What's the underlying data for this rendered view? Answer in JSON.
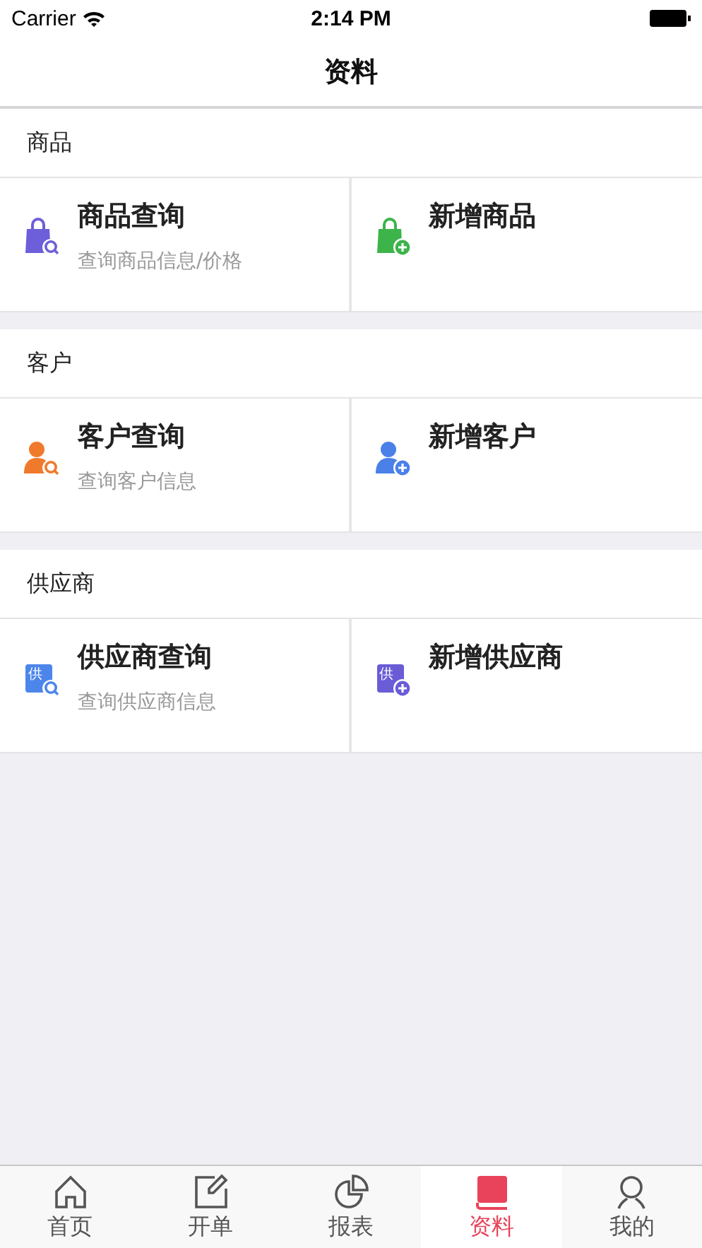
{
  "status_bar": {
    "carrier": "Carrier",
    "time": "2:14 PM"
  },
  "nav": {
    "title": "资料"
  },
  "sections": [
    {
      "title": "商品",
      "items": [
        {
          "kind": "search",
          "color": "#6c5fd9",
          "title": "商品查询",
          "subtitle": "查询商品信息/价格"
        },
        {
          "kind": "add",
          "color": "#3cb44a",
          "title": "新增商品"
        }
      ]
    },
    {
      "title": "客户",
      "items": [
        {
          "kind": "search",
          "color": "#f07a2c",
          "title": "客户查询",
          "subtitle": "查询客户信息"
        },
        {
          "kind": "add",
          "color": "#4a80e8",
          "title": "新增客户"
        }
      ]
    },
    {
      "title": "供应商",
      "items": [
        {
          "kind": "search",
          "icon_glyph": "供",
          "color": "#4c86ea",
          "title": "供应商查询",
          "subtitle": "查询供应商信息"
        },
        {
          "kind": "add",
          "icon_glyph": "供",
          "color": "#6a5cd6",
          "title": "新增供应商"
        }
      ]
    }
  ],
  "tab_bar": [
    {
      "label": "首页",
      "selected": false
    },
    {
      "label": "开单",
      "selected": false
    },
    {
      "label": "报表",
      "selected": false
    },
    {
      "label": "资料",
      "selected": true
    },
    {
      "label": "我的",
      "selected": false
    }
  ]
}
